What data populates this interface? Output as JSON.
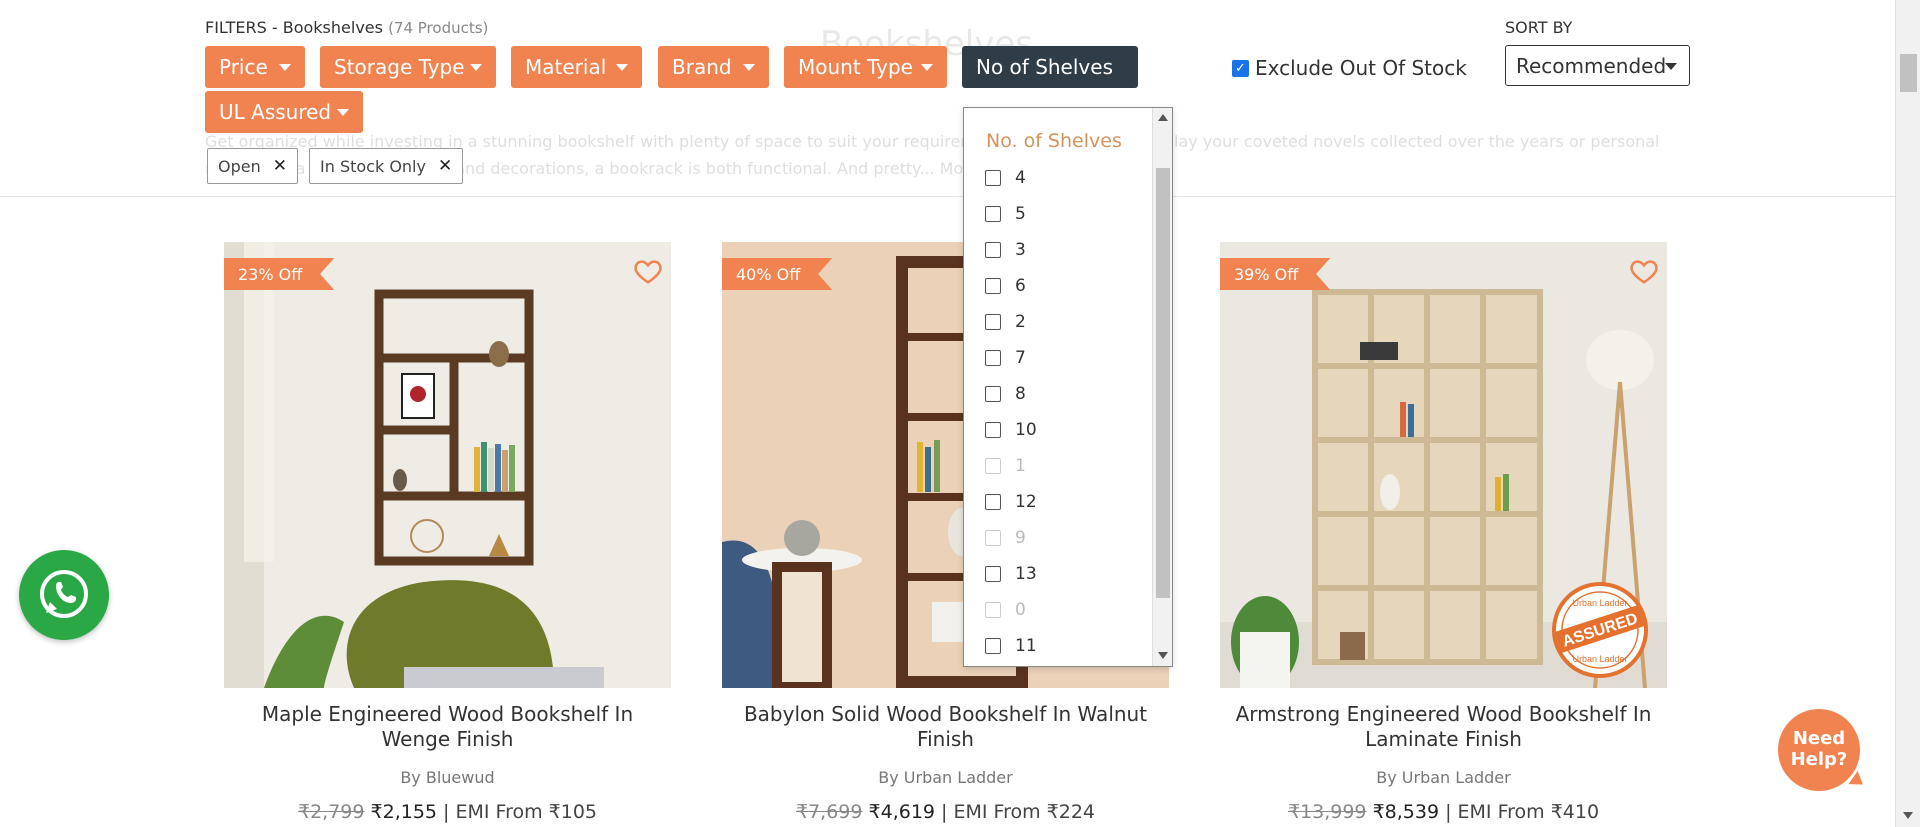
{
  "page_title": "Bookshelves",
  "filters": {
    "label": "FILTERS - Bookshelves",
    "count": "(74 Products)",
    "buttons": [
      {
        "label": "Price"
      },
      {
        "label": "Storage Type"
      },
      {
        "label": "Material"
      },
      {
        "label": "Brand"
      },
      {
        "label": "Mount Type"
      },
      {
        "label": "No of Shelves"
      },
      {
        "label": "UL Assured"
      }
    ],
    "chips": [
      {
        "label": "Open"
      },
      {
        "label": "In Stock Only"
      }
    ]
  },
  "description": "Get organized while investing in a stunning bookshelf with plenty of space to suit your requirement. Whether it is to display your coveted novels collected over the years or personal memorabilia like photo frames and decorations, a bookrack is both functional. And pretty... More",
  "exclude_out_of_stock": {
    "label": "Exclude Out Of Stock",
    "checked": true
  },
  "sort": {
    "label": "SORT BY",
    "value": "Recommended"
  },
  "shelves_dropdown": {
    "title": "No. of Shelves",
    "options": [
      {
        "label": "4",
        "enabled": true
      },
      {
        "label": "5",
        "enabled": true
      },
      {
        "label": "3",
        "enabled": true
      },
      {
        "label": "6",
        "enabled": true
      },
      {
        "label": "2",
        "enabled": true
      },
      {
        "label": "7",
        "enabled": true
      },
      {
        "label": "8",
        "enabled": true
      },
      {
        "label": "10",
        "enabled": true
      },
      {
        "label": "1",
        "enabled": false
      },
      {
        "label": "12",
        "enabled": true
      },
      {
        "label": "9",
        "enabled": false
      },
      {
        "label": "13",
        "enabled": true
      },
      {
        "label": "0",
        "enabled": false
      },
      {
        "label": "11",
        "enabled": true
      }
    ]
  },
  "products": [
    {
      "discount": "23% Off",
      "title_line1": "Maple Engineered Wood Bookshelf In",
      "title_line2": "Wenge Finish",
      "brand": "By Bluewud",
      "old_price": "₹2,799",
      "new_price": "₹2,155",
      "emi": "| EMI From ₹105"
    },
    {
      "discount": "40% Off",
      "title_line1": "Babylon Solid Wood Bookshelf In Walnut",
      "title_line2": "Finish",
      "brand": "By Urban Ladder",
      "old_price": "₹7,699",
      "new_price": "₹4,619",
      "emi": "| EMI From ₹224"
    },
    {
      "discount": "39% Off",
      "title_line1": "Armstrong Engineered Wood Bookshelf In",
      "title_line2": "Laminate Finish",
      "brand": "By Urban Ladder",
      "old_price": "₹13,999",
      "new_price": "₹8,539",
      "emi": "| EMI From ₹410",
      "assured_stamp": "ASSURED",
      "assured_text": "Urban Ladder"
    }
  ],
  "help": {
    "line1": "Need",
    "line2": "Help?"
  },
  "colors": {
    "accent": "#f0834f",
    "active_filter": "#2e3d48",
    "whatsapp": "#2aa845"
  }
}
